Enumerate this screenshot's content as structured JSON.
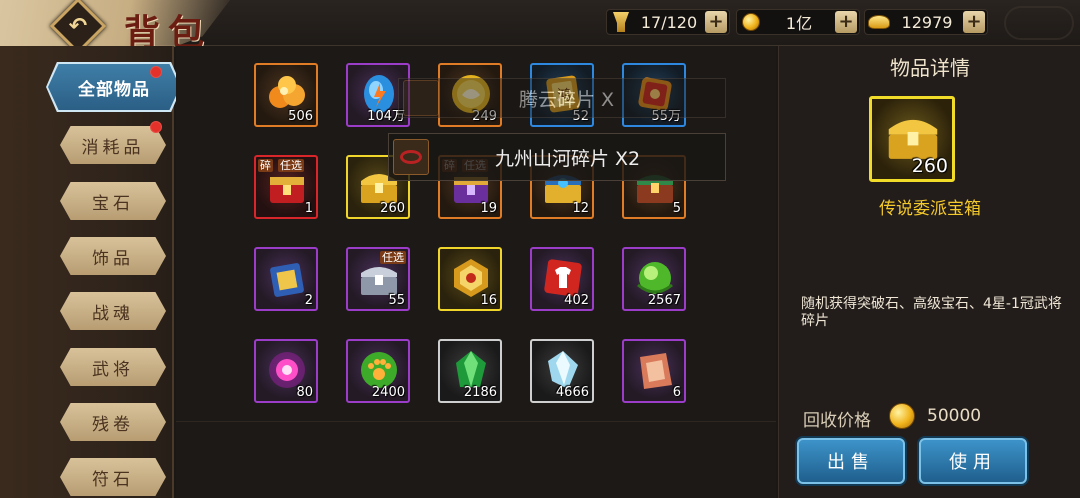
{
  "header": {
    "back_glyph": "↶",
    "title": "背包",
    "resources": [
      {
        "icon": "bag-capacity-icon",
        "value": "17/120"
      },
      {
        "icon": "gold-coin-icon",
        "value": "1亿"
      },
      {
        "icon": "gold-ingot-icon",
        "value": "12979"
      }
    ],
    "plus_glyph": "+"
  },
  "sidebar": {
    "tabs": [
      {
        "label": "全部物品",
        "active": true,
        "badge": true
      },
      {
        "label": "消耗品",
        "active": false,
        "badge": true
      },
      {
        "label": "宝石",
        "active": false,
        "badge": false
      },
      {
        "label": "饰品",
        "active": false,
        "badge": false
      },
      {
        "label": "战魂",
        "active": false,
        "badge": false
      },
      {
        "label": "武将",
        "active": false,
        "badge": false
      },
      {
        "label": "残卷",
        "active": false,
        "badge": false
      },
      {
        "label": "符石",
        "active": false,
        "badge": false
      }
    ]
  },
  "grid": {
    "items": [
      {
        "icon": "orange-gem-cluster-icon",
        "count": "506",
        "rarity": "orange"
      },
      {
        "icon": "blue-lightning-crystal-icon",
        "count": "104万",
        "rarity": "purple"
      },
      {
        "icon": "gold-medal-icon",
        "count": "249",
        "rarity": "orange"
      },
      {
        "icon": "seal-token-icon",
        "count": "52",
        "rarity": "blue"
      },
      {
        "icon": "red-scroll-icon",
        "count": "55万",
        "rarity": "blue"
      },
      {
        "icon": "red-chest-icon",
        "count": "1",
        "rarity": "red",
        "tags": [
          "碎",
          "任选"
        ]
      },
      {
        "icon": "gold-chest-icon",
        "count": "260",
        "rarity": "yellow",
        "selected": true
      },
      {
        "icon": "purple-chest-icon",
        "count": "19",
        "rarity": "orange",
        "tags": [
          "碎",
          "任选"
        ]
      },
      {
        "icon": "blue-gold-chest-icon",
        "count": "12",
        "rarity": "orange"
      },
      {
        "icon": "green-chest-icon",
        "count": "5",
        "rarity": "orange"
      },
      {
        "icon": "blue-gold-box-icon",
        "count": "2",
        "rarity": "purple"
      },
      {
        "icon": "silver-chest-icon",
        "count": "55",
        "rarity": "purple",
        "tags": [
          "任选"
        ]
      },
      {
        "icon": "gold-token-icon",
        "count": "16",
        "rarity": "yellow"
      },
      {
        "icon": "shirt-card-icon",
        "count": "402",
        "rarity": "purple"
      },
      {
        "icon": "green-orb-icon",
        "count": "2567",
        "rarity": "purple"
      },
      {
        "icon": "pink-energy-orb-icon",
        "count": "80",
        "rarity": "purple"
      },
      {
        "icon": "green-paw-orb-icon",
        "count": "2400",
        "rarity": "purple"
      },
      {
        "icon": "green-crystal-icon",
        "count": "2186",
        "rarity": "gray"
      },
      {
        "icon": "white-crystal-icon",
        "count": "4666",
        "rarity": "gray"
      },
      {
        "icon": "red-paper-fragment-icon",
        "count": "6",
        "rarity": "purple"
      }
    ]
  },
  "toasts": [
    {
      "text": "腾云碎片 X",
      "icon": "scroll-fragment-icon"
    },
    {
      "text": "九州山河碎片 X2",
      "icon": "scroll-fragment-icon"
    }
  ],
  "detail": {
    "title": "物品详情",
    "item_count": "260",
    "item_icon": "gold-chest-icon",
    "item_name": "传说委派宝箱",
    "description": "随机获得突破石、高级宝石、4星-1冠武将碎片",
    "price_label": "回收价格",
    "price_value": "50000",
    "sell_label": "出售",
    "use_label": "使用"
  },
  "colors": {
    "accent_blue": "#2b5f86",
    "rarity_purple": "#9b3dc9",
    "rarity_orange": "#e07b26",
    "rarity_blue": "#2e88e0",
    "rarity_red": "#d8262a",
    "rarity_yellow": "#f0d62a",
    "item_name_gold": "#f4c92a"
  }
}
